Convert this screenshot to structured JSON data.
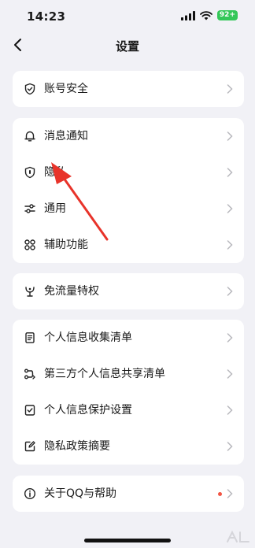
{
  "status_bar": {
    "time": "14:23",
    "battery": "92+"
  },
  "nav": {
    "title": "设置"
  },
  "groups": [
    {
      "items": [
        {
          "label": "账号安全",
          "icon": "shield-check-icon"
        }
      ]
    },
    {
      "items": [
        {
          "label": "消息通知",
          "icon": "bell-icon"
        },
        {
          "label": "隐私",
          "icon": "privacy-shield-icon"
        },
        {
          "label": "通用",
          "icon": "sliders-icon"
        },
        {
          "label": "辅助功能",
          "icon": "grid-icon"
        }
      ]
    },
    {
      "items": [
        {
          "label": "免流量特权",
          "icon": "data-free-icon"
        }
      ]
    },
    {
      "items": [
        {
          "label": "个人信息收集清单",
          "icon": "document-list-icon"
        },
        {
          "label": "第三方个人信息共享清单",
          "icon": "share-icon"
        },
        {
          "label": "个人信息保护设置",
          "icon": "checkbox-icon"
        },
        {
          "label": "隐私政策摘要",
          "icon": "edit-icon"
        }
      ]
    },
    {
      "items": [
        {
          "label": "关于QQ与帮助",
          "icon": "info-icon",
          "badge": "red-dot"
        }
      ]
    }
  ],
  "colors": {
    "background": "#f1f1f6",
    "card": "#ffffff",
    "annotation_arrow": "#e8332a",
    "badge": "#f25544",
    "battery": "#34c759"
  }
}
